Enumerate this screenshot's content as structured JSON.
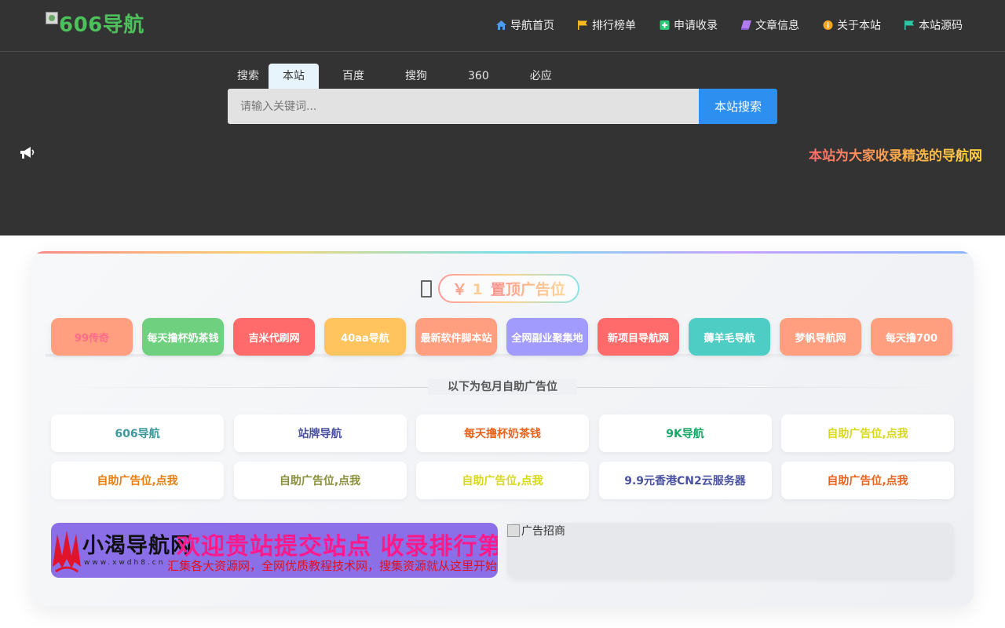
{
  "header": {
    "logo_text": "606导航",
    "nav": [
      {
        "label": "导航首页",
        "icon": "home-icon",
        "color": "#4f9bf0"
      },
      {
        "label": "排行榜单",
        "icon": "flag-icon",
        "color": "#f5b820"
      },
      {
        "label": "申请收录",
        "icon": "plus-square-icon",
        "color": "#2ec77a"
      },
      {
        "label": "文章信息",
        "icon": "book-icon",
        "color": "#b07cf0"
      },
      {
        "label": "关于本站",
        "icon": "info-icon",
        "color": "#f5a623"
      },
      {
        "label": "本站源码",
        "icon": "flag-icon",
        "color": "#2ec7a6"
      }
    ]
  },
  "search": {
    "tabs_label": "搜索",
    "tabs": [
      "本站",
      "百度",
      "搜狗",
      "360",
      "必应"
    ],
    "active_tab": "本站",
    "placeholder": "请输入关键词...",
    "button": "本站搜索"
  },
  "announcement": {
    "icon": "megaphone-icon",
    "text": "本站为大家收录精选的导航网"
  },
  "pinned": {
    "price": "￥ 1",
    "title": "置顶广告位",
    "items": [
      {
        "label": "99传奇",
        "bg": "#ff9f7f",
        "fg": "#ff6b8a"
      },
      {
        "label": "每天撸杯奶茶钱",
        "bg": "#6fd080",
        "fg": "#ffffff"
      },
      {
        "label": "吉米代刷网",
        "bg": "#ff6b6b",
        "fg": "#ffffff"
      },
      {
        "label": "40aa导航",
        "bg": "#ffc45e",
        "fg": "#ffffff"
      },
      {
        "label": "最新软件脚本站",
        "bg": "#ff9f7f",
        "fg": "#ffffff"
      },
      {
        "label": "全网副业聚集地",
        "bg": "#a29bfe",
        "fg": "#ffffff"
      },
      {
        "label": "新项目导航网",
        "bg": "#ff6b6b",
        "fg": "#ffffff"
      },
      {
        "label": "薅羊毛导航",
        "bg": "#4ecdc4",
        "fg": "#ffffff"
      },
      {
        "label": "梦帆导航网",
        "bg": "#ff9f7f",
        "fg": "#ffffff"
      },
      {
        "label": "每天撸700",
        "bg": "#ff9f7f",
        "fg": "#ffffff"
      }
    ]
  },
  "monthly": {
    "divider_label": "以下为包月自助广告位",
    "items": [
      {
        "label": "606导航",
        "color": "#3d9a9a"
      },
      {
        "label": "站牌导航",
        "color": "#4a52a0"
      },
      {
        "label": "每天撸杯奶茶钱",
        "color": "#e8641e"
      },
      {
        "label": "9K导航",
        "color": "#19a867"
      },
      {
        "label": "自助广告位,点我",
        "color": "#d8d81a"
      },
      {
        "label": "自助广告位,点我",
        "color": "#e87d0d"
      },
      {
        "label": "自助广告位,点我",
        "color": "#8a8f3a"
      },
      {
        "label": "自助广告位,点我",
        "color": "#d8d81a"
      },
      {
        "label": "9.9元香港CN2云服务器",
        "color": "#4a52a0"
      },
      {
        "label": "自助广告位,点我",
        "color": "#e8641e"
      }
    ]
  },
  "banners": {
    "left": {
      "logo_text": "小渴导航网",
      "url": "www.xwdh8.cn",
      "headline": "欢迎贵站提交站点 收录排行第一名",
      "subline": "汇集各大资源网，全网优质教程技术网，搜集资源就从这里开始"
    },
    "right": {
      "alt": "广告招商"
    }
  }
}
